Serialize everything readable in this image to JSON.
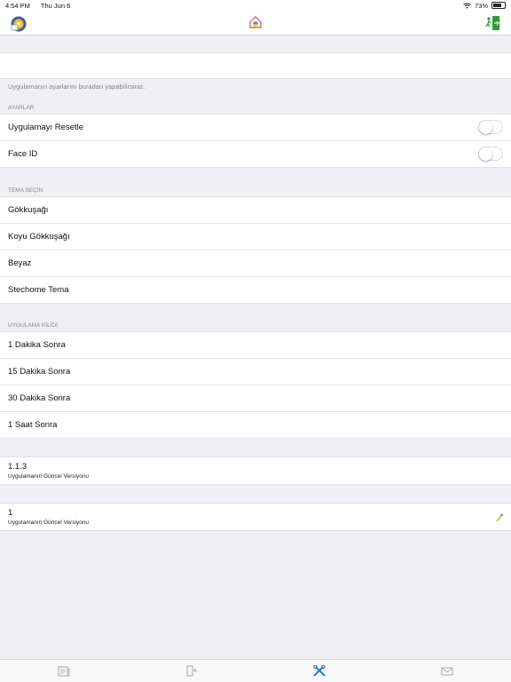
{
  "status_bar": {
    "time": "4:54 PM",
    "date": "Thu Jun 6",
    "battery": "73%",
    "battery_level": 0.73
  },
  "intro_text": "Uygulamanın ayarlarını buradan yapabilirsiniz.",
  "sections": {
    "ayarlar": {
      "header": "AYARLAR",
      "rows": [
        {
          "label": "Uygulamayı Resetle",
          "toggle": false
        },
        {
          "label": "Face ID",
          "toggle": false
        }
      ]
    },
    "tema": {
      "header": "TEMA SEÇİN",
      "rows": [
        "Gökkuşağı",
        "Koyu Gökkuşağı",
        "Beyaz",
        "Stechome Tema"
      ]
    },
    "kilit": {
      "header": "UYGULAMA KİLİDİ",
      "rows": [
        "1 Dakika Sonra",
        "15 Dakika Sonra",
        "30 Dakika Sonra",
        "1 Saat Sonra"
      ]
    }
  },
  "version_rows": [
    {
      "value": "1.1.3",
      "caption": "Uygulamanın Güncel Versiyonu"
    },
    {
      "value": "1",
      "caption": "Uygulamanın Güncel Versiyonu"
    }
  ],
  "icons": {
    "nav_left": "settings-disc-icon",
    "nav_center": "home-logo-icon",
    "nav_right": "exit-icon",
    "tabs": [
      "news-icon",
      "door-icon",
      "tools-icon",
      "mail-icon"
    ]
  },
  "colors": {
    "exit_green": "#2e9b3a",
    "active_tab": "#2a7bd1",
    "inactive_tab": "#a9a9ae"
  }
}
